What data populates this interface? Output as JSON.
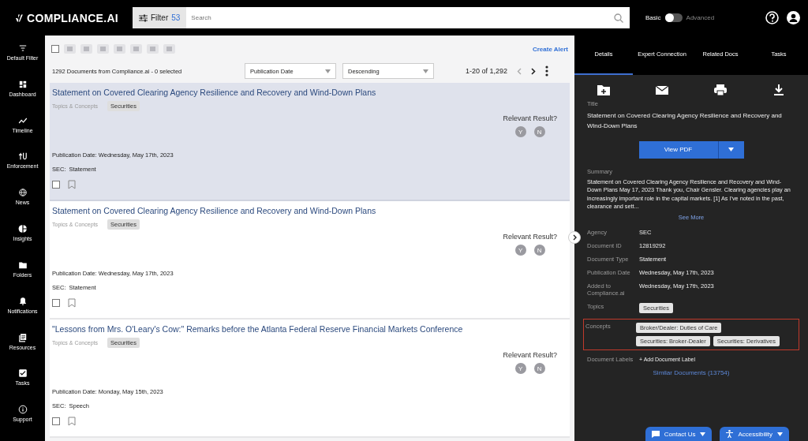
{
  "header": {
    "logo": "COMPLIANCE.AI",
    "filter_label": "Filter",
    "filter_count": "53",
    "search_placeholder": "Search",
    "mode_basic": "Basic",
    "mode_advanced": "Advanced",
    "advanced_on": false
  },
  "nav": [
    {
      "label": "Default Filter"
    },
    {
      "label": "Dashboard"
    },
    {
      "label": "Timeline"
    },
    {
      "label": "Enforcement"
    },
    {
      "label": "News"
    },
    {
      "label": "Insights"
    },
    {
      "label": "Folders"
    },
    {
      "label": "Notifications"
    },
    {
      "label": "Resources"
    },
    {
      "label": "Tasks"
    },
    {
      "label": "Support"
    }
  ],
  "toolbar": {
    "create_alert": "Create Alert",
    "select_all_checked": false
  },
  "list_header": {
    "count": "1292 Documents from Compliance.ai - 0 selected",
    "sort_field": "Publication Date",
    "sort_order": "Descending",
    "range": "1-20 of 1,292"
  },
  "documents": [
    {
      "title": "Statement on Covered Clearing Agency Resilience and Recovery and Wind-Down Plans",
      "topics_label": "Topics & Concepts",
      "tags": [
        "Securities"
      ],
      "relevant_label": "Relevant Result?",
      "yes": "Y",
      "no": "N",
      "date": "Publication Date: Wednesday, May 17th, 2023",
      "source": "SEC:",
      "doc_type": "Statement",
      "selected": true,
      "checked": false,
      "bookmarked": false
    },
    {
      "title": "Statement on Covered Clearing Agency Resilience and Recovery and Wind-Down Plans",
      "topics_label": "Topics & Concepts",
      "tags": [
        "Securities"
      ],
      "relevant_label": "Relevant Result?",
      "yes": "Y",
      "no": "N",
      "date": "Publication Date: Wednesday, May 17th, 2023",
      "source": "SEC:",
      "doc_type": "Statement",
      "selected": false,
      "checked": false,
      "bookmarked": false
    },
    {
      "title": "\"Lessons from Mrs. O'Leary's Cow:\" Remarks before the Atlanta Federal Reserve Financial Markets Conference",
      "topics_label": "Topics & Concepts",
      "tags": [
        "Securities"
      ],
      "relevant_label": "Relevant Result?",
      "yes": "Y",
      "no": "N",
      "date": "Publication Date: Monday, May 15th, 2023",
      "source": "SEC:",
      "doc_type": "Speech",
      "selected": false,
      "checked": false,
      "bookmarked": false
    }
  ],
  "details": {
    "tabs": [
      {
        "label": "Details",
        "selected": true
      },
      {
        "label": "Expert Connection",
        "selected": false
      },
      {
        "label": "Related Docs",
        "selected": false
      },
      {
        "label": "Tasks",
        "selected": false
      }
    ],
    "title_label": "Title",
    "title": "Statement on Covered Clearing Agency Resilience and Recovery and Wind-Down Plans",
    "view_pdf": "View PDF",
    "summary_label": "Summary",
    "summary": "Statement on Covered Clearing Agency Resilience and Recovery and Wind-Down Plans May 17, 2023 Thank you, Chair Gensler. Clearing agencies play an increasingly important role in the capital markets. [1] As I've noted in the past, clearance and sett...",
    "see_more": "See More",
    "fields": [
      {
        "label": "Agency",
        "value": "SEC"
      },
      {
        "label": "Document ID",
        "value": "12819292"
      },
      {
        "label": "Document Type",
        "value": "Statement"
      },
      {
        "label": "Publication Date",
        "value": "Wednesday, May 17th, 2023"
      },
      {
        "label": "Added to Compliance.ai",
        "value": "Wednesday, May 17th, 2023"
      }
    ],
    "topics_label": "Topics",
    "topics": [
      "Securities"
    ],
    "concepts_label": "Concepts",
    "concepts": [
      "Broker/Dealer: Duties of Care",
      "Securities: Broker-Dealer",
      "Securities: Derivatives"
    ],
    "concepts_highlighted": true,
    "labels_label": "Document Labels",
    "add_label": "+ Add Document Label",
    "similar": "Similar Documents (13754)"
  },
  "floating": {
    "contact": "Contact Us",
    "accessibility": "Accessibility"
  }
}
